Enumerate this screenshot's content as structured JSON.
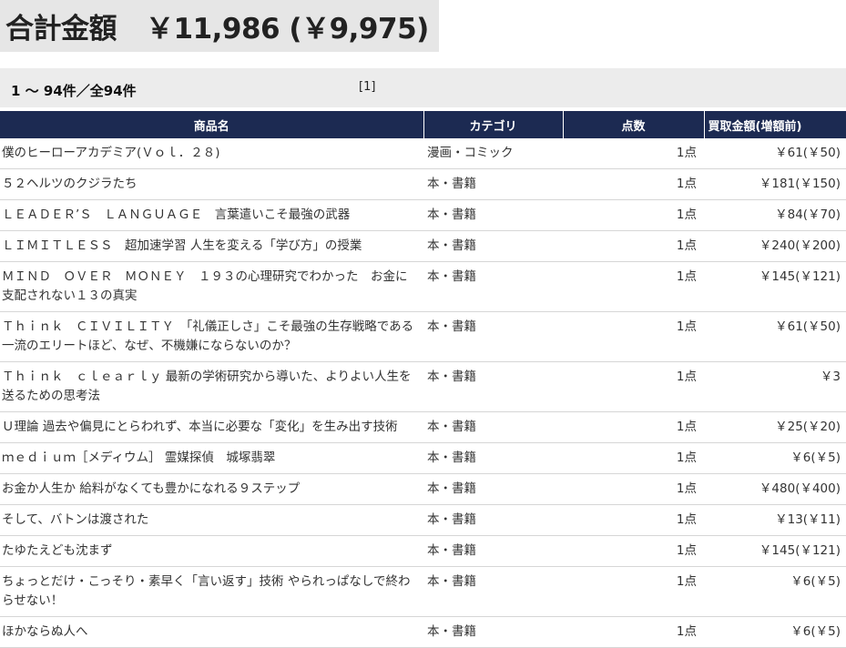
{
  "summary": {
    "label": "合計金額",
    "total": "￥11,986 (￥9,975)"
  },
  "pagination": {
    "count_text": "1 ～ 94件／全94件",
    "page_link": "[1]"
  },
  "table": {
    "headers": [
      "商品名",
      "カテゴリ",
      "点数",
      "買取金額(増額前)"
    ],
    "rows": [
      {
        "name": "僕のヒーローアカデミア(Ｖｏｌ．２８)",
        "category": "漫画・コミック",
        "qty": "1点",
        "price": "￥61(￥50)"
      },
      {
        "name": "５２ヘルツのクジラたち",
        "category": "本・書籍",
        "qty": "1点",
        "price": "￥181(￥150)"
      },
      {
        "name": "ＬＥＡＤＥＲ’Ｓ　ＬＡＮＧＵＡＧＥ　言葉遣いこそ最強の武器",
        "category": "本・書籍",
        "qty": "1点",
        "price": "￥84(￥70)"
      },
      {
        "name": "ＬＩＭＩＴＬＥＳＳ　超加速学習 人生を変える「学び方」の授業",
        "category": "本・書籍",
        "qty": "1点",
        "price": "￥240(￥200)"
      },
      {
        "name": "ＭＩＮＤ　ＯＶＥＲ　ＭＯＮＥＹ　１９３の心理研究でわかった　お金に支配されない１３の真実",
        "category": "本・書籍",
        "qty": "1点",
        "price": "￥145(￥121)"
      },
      {
        "name": "Ｔｈｉｎｋ　ＣＩＶＩＬＩＴＹ　「礼儀正しさ」こそ最強の生存戦略である 一流のエリートほど、なぜ、不機嫌にならないのか？",
        "category": "本・書籍",
        "qty": "1点",
        "price": "￥61(￥50)"
      },
      {
        "name": "Ｔｈｉｎｋ　ｃｌｅａｒｌｙ 最新の学術研究から導いた、よりよい人生を送るための思考法",
        "category": "本・書籍",
        "qty": "1点",
        "price": "￥3"
      },
      {
        "name": "Ｕ理論 過去や偏見にとらわれず、本当に必要な「変化」を生み出す技術",
        "category": "本・書籍",
        "qty": "1点",
        "price": "￥25(￥20)"
      },
      {
        "name": "ｍｅｄｉｕｍ［メディウム］ 霊媒探偵　城塚翡翠",
        "category": "本・書籍",
        "qty": "1点",
        "price": "￥6(￥5)"
      },
      {
        "name": "お金か人生か 給料がなくても豊かになれる９ステップ",
        "category": "本・書籍",
        "qty": "1点",
        "price": "￥480(￥400)"
      },
      {
        "name": "そして、バトンは渡された",
        "category": "本・書籍",
        "qty": "1点",
        "price": "￥13(￥11)"
      },
      {
        "name": "たゆたえども沈まず",
        "category": "本・書籍",
        "qty": "1点",
        "price": "￥145(￥121)"
      },
      {
        "name": "ちょっとだけ・こっそり・素早く「言い返す」技術 やられっぱなしで終わらせない！",
        "category": "本・書籍",
        "qty": "1点",
        "price": "￥6(￥5)"
      },
      {
        "name": "ほかならぬ人へ",
        "category": "本・書籍",
        "qty": "1点",
        "price": "￥6(￥5)"
      }
    ]
  },
  "colors": {
    "header_bg": "#1c2a52",
    "summary_bg": "#e6e6e6",
    "bar_bg": "#ececec"
  }
}
